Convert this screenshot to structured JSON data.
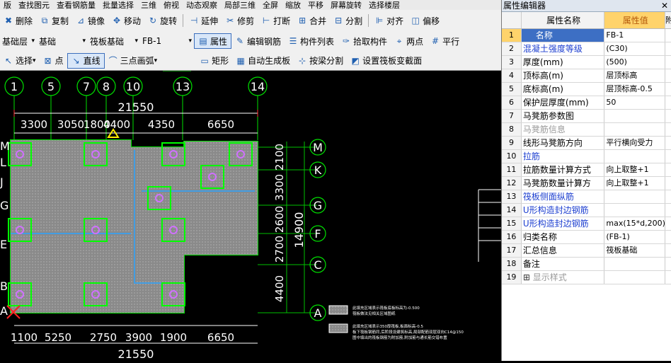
{
  "menubar": {
    "items": [
      "版",
      "查找图元",
      "查看钢筋量",
      "批量选择",
      "三维",
      "俯视",
      "动态观察",
      "局部三维",
      "全屏",
      "缩放",
      "平移",
      "屏幕旋转",
      "选择楼层"
    ]
  },
  "toolbar1": {
    "items": [
      {
        "icon": "delete-icon",
        "glyph": "✖",
        "label": "删除"
      },
      {
        "icon": "copy-icon",
        "glyph": "⧉",
        "label": "复制"
      },
      {
        "icon": "mirror-icon",
        "glyph": "⊿",
        "label": "镜像"
      },
      {
        "icon": "move-icon",
        "glyph": "✥",
        "label": "移动"
      },
      {
        "icon": "rotate-icon",
        "glyph": "↻",
        "label": "旋转"
      },
      {
        "icon": "extend-icon",
        "glyph": "⊣",
        "label": "延伸"
      },
      {
        "icon": "trim-icon",
        "glyph": "✂",
        "label": "修剪"
      },
      {
        "icon": "break-icon",
        "glyph": "⊢",
        "label": "打断"
      },
      {
        "icon": "merge-icon",
        "glyph": "⊞",
        "label": "合并"
      },
      {
        "icon": "split-icon",
        "glyph": "⊟",
        "label": "分割"
      },
      {
        "icon": "align-icon",
        "glyph": "⊫",
        "label": "对齐"
      },
      {
        "icon": "offset-icon",
        "glyph": "◫",
        "label": "偏移"
      }
    ]
  },
  "toolbar2": {
    "floor_type": "基础层",
    "floor": "基础",
    "component_type": "筏板基础",
    "component": "FB-1",
    "buttons": [
      {
        "icon": "properties-icon",
        "glyph": "▤",
        "label": "属性"
      },
      {
        "icon": "edit-rebar-icon",
        "glyph": "✎",
        "label": "编辑钢筋"
      },
      {
        "icon": "component-list-icon",
        "glyph": "☰",
        "label": "构件列表"
      },
      {
        "icon": "pick-component-icon",
        "glyph": "✑",
        "label": "拾取构件"
      },
      {
        "icon": "two-points-icon",
        "glyph": "⌖",
        "label": "两点"
      },
      {
        "icon": "parallel-icon",
        "glyph": "#",
        "label": "平行"
      }
    ]
  },
  "toolbar3": {
    "items": [
      {
        "icon": "select-icon",
        "glyph": "↖",
        "label": "选择",
        "dropdown": true
      },
      {
        "icon": "point-icon",
        "glyph": "⊠",
        "label": "点"
      },
      {
        "icon": "line-icon",
        "glyph": "↘",
        "label": "直线",
        "active": true
      },
      {
        "icon": "arc-icon",
        "glyph": "⌒",
        "label": "三点画弧",
        "dropdown": true
      },
      {
        "icon": "rect-icon",
        "glyph": "▭",
        "label": "矩形"
      },
      {
        "icon": "auto-slab-icon",
        "glyph": "▦",
        "label": "自动生成板"
      },
      {
        "icon": "split-by-beam-icon",
        "glyph": "⊹",
        "label": "按梁分割"
      },
      {
        "icon": "set-slab-edge-icon",
        "glyph": "◩",
        "label": "设置筏板变截面"
      }
    ]
  },
  "drawing": {
    "axis_top": [
      "1",
      "5",
      "7",
      "8",
      "10",
      "13",
      "14"
    ],
    "axis_right": [
      "M",
      "K",
      "G",
      "F",
      "C",
      "A"
    ],
    "axis_left": [
      "M",
      "L",
      "J",
      "G",
      "E",
      "B",
      "A"
    ],
    "total_width": "21550",
    "dims_top": [
      "3300",
      "3050",
      "1800",
      "4400",
      "4350",
      "6650"
    ],
    "dims_bottom": [
      "1100",
      "5250",
      "2750",
      "3900",
      "1900",
      "6650"
    ],
    "total_bottom": "21550",
    "dims_right": [
      "2100",
      "3300",
      "2600",
      "2700",
      "4400"
    ],
    "total_right": "14900",
    "legend_1": "此填充区域表示筏板底板标高为-0.500",
    "legend_1b": "筏板做法见相关区域图纸",
    "legend_2": "此填充区域表示350厚筏板,板面标高-0.5",
    "legend_2b": "板下筏板钢筋同,后阶段设建筑标高,局部配筋双层双向C14@150",
    "legend_2c": "图中填出的筏板钢筋为附加筋,附加筋与通长筋交错布置"
  },
  "panel": {
    "title": "属性编辑器",
    "col_name": "属性名称",
    "col_value": "属性值",
    "col_extra": "附",
    "rows": [
      {
        "no": "1",
        "name": "名称",
        "value": "FB-1",
        "style": "blue",
        "selected": true
      },
      {
        "no": "2",
        "name": "混凝土强度等级",
        "value": "(C30)",
        "style": "blue"
      },
      {
        "no": "3",
        "name": "厚度(mm)",
        "value": "(500)",
        "style": ""
      },
      {
        "no": "4",
        "name": "顶标高(m)",
        "value": "层顶标高",
        "style": ""
      },
      {
        "no": "5",
        "name": "底标高(m)",
        "value": "层顶标高-0.5",
        "style": ""
      },
      {
        "no": "6",
        "name": "保护层厚度(mm)",
        "value": "50",
        "style": ""
      },
      {
        "no": "7",
        "name": "马凳筋参数图",
        "value": "",
        "style": ""
      },
      {
        "no": "8",
        "name": "马凳筋信息",
        "value": "",
        "style": "gray"
      },
      {
        "no": "9",
        "name": "线形马凳筋方向",
        "value": "平行横向受力",
        "style": ""
      },
      {
        "no": "10",
        "name": "拉筋",
        "value": "",
        "style": "blue"
      },
      {
        "no": "11",
        "name": "拉筋数量计算方式",
        "value": "向上取整+1",
        "style": ""
      },
      {
        "no": "12",
        "name": "马凳筋数量计算方",
        "value": "向上取整+1",
        "style": ""
      },
      {
        "no": "13",
        "name": "筏板侧面纵筋",
        "value": "",
        "style": "blue"
      },
      {
        "no": "14",
        "name": "U形构造封边钢筋",
        "value": "",
        "style": "blue"
      },
      {
        "no": "15",
        "name": "U形构造封边钢筋",
        "value": "max(15*d,200)",
        "style": "blue"
      },
      {
        "no": "16",
        "name": "归类名称",
        "value": "(FB-1)",
        "style": ""
      },
      {
        "no": "17",
        "name": "汇总信息",
        "value": "筏板基础",
        "style": ""
      },
      {
        "no": "18",
        "name": "备注",
        "value": "",
        "style": ""
      },
      {
        "no": "19",
        "name": "显示样式",
        "value": "",
        "style": "gray",
        "expand": true
      }
    ]
  }
}
